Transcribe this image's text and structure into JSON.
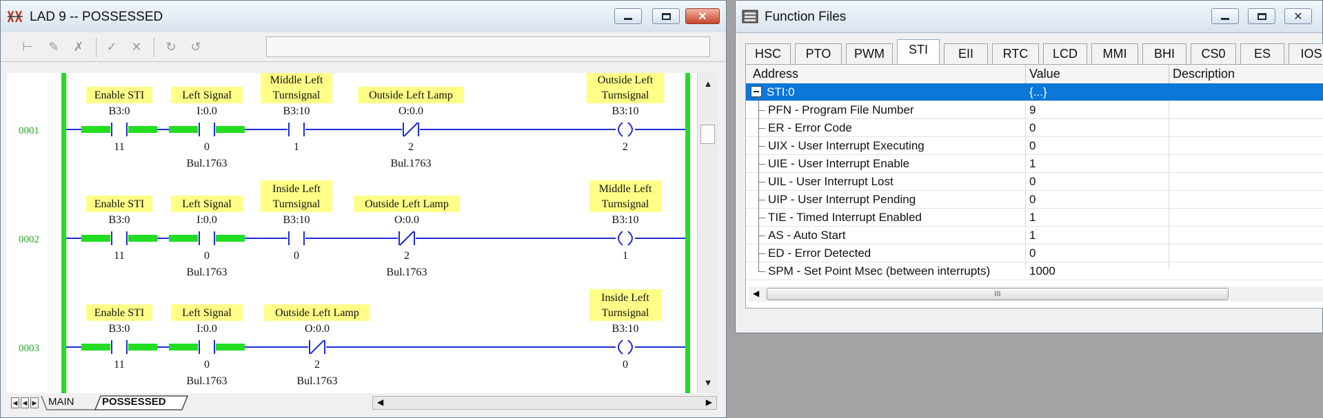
{
  "lad_window": {
    "title": "LAD 9 -- POSSESSED",
    "sheet_tabs": [
      "MAIN",
      "POSSESSED"
    ],
    "rungs": [
      {
        "number": "0001",
        "contacts": [
          {
            "label": [
              "Enable STI"
            ],
            "address": "B3:0",
            "bit": "11",
            "device": "",
            "type": "no",
            "energized": true
          },
          {
            "label": [
              "Left Signal"
            ],
            "address": "I:0.0",
            "bit": "0",
            "device": "Bul.1763",
            "type": "no",
            "energized": true
          },
          {
            "label": [
              "Middle Left",
              "Turnsignal"
            ],
            "address": "B3:10",
            "bit": "1",
            "device": "",
            "type": "no",
            "energized": false
          },
          {
            "label": [
              "Outside Left Lamp"
            ],
            "address": "O:0.0",
            "bit": "2",
            "device": "Bul.1763",
            "type": "nc",
            "energized": false
          }
        ],
        "coil": {
          "label": [
            "Outside Left",
            "Turnsignal"
          ],
          "address": "B3:10",
          "bit": "2"
        }
      },
      {
        "number": "0002",
        "contacts": [
          {
            "label": [
              "Enable STI"
            ],
            "address": "B3:0",
            "bit": "11",
            "device": "",
            "type": "no",
            "energized": true
          },
          {
            "label": [
              "Left Signal"
            ],
            "address": "I:0.0",
            "bit": "0",
            "device": "Bul.1763",
            "type": "no",
            "energized": true
          },
          {
            "label": [
              "Inside Left",
              "Turnsignal"
            ],
            "address": "B3:10",
            "bit": "0",
            "device": "",
            "type": "no",
            "energized": false
          },
          {
            "label": [
              "Outside Left Lamp"
            ],
            "address": "O:0.0",
            "bit": "2",
            "device": "Bul.1763",
            "type": "nc",
            "energized": false
          }
        ],
        "coil": {
          "label": [
            "Middle Left",
            "Turnsignal"
          ],
          "address": "B3:10",
          "bit": "1"
        }
      },
      {
        "number": "0003",
        "contacts": [
          {
            "label": [
              "Enable STI"
            ],
            "address": "B3:0",
            "bit": "11",
            "device": "",
            "type": "no",
            "energized": true
          },
          {
            "label": [
              "Left Signal"
            ],
            "address": "I:0.0",
            "bit": "0",
            "device": "Bul.1763",
            "type": "no",
            "energized": true
          },
          {
            "label": [
              "Outside Left Lamp"
            ],
            "address": "O:0.0",
            "bit": "2",
            "device": "Bul.1763",
            "type": "nc",
            "energized": false
          }
        ],
        "coil": {
          "label": [
            "Inside Left",
            "Turnsignal"
          ],
          "address": "B3:10",
          "bit": "0"
        }
      }
    ]
  },
  "ff_window": {
    "title": "Function Files",
    "tabs": [
      "HSC",
      "PTO",
      "PWM",
      "STI",
      "EII",
      "RTC",
      "LCD",
      "MMI",
      "BHI",
      "CS0",
      "ES",
      "IOS"
    ],
    "active_tab": "STI",
    "columns": [
      "Address",
      "Value",
      "Description"
    ],
    "root": {
      "address": "STI:0",
      "value": "{...}"
    },
    "rows": [
      {
        "address": "PFN - Program File Number",
        "value": "9"
      },
      {
        "address": "ER - Error Code",
        "value": "0"
      },
      {
        "address": "UIX - User Interrupt Executing",
        "value": "0"
      },
      {
        "address": "UIE - User Interrupt Enable",
        "value": "1"
      },
      {
        "address": "UIL - User Interrupt Lost",
        "value": "0"
      },
      {
        "address": "UIP - User Interrupt Pending",
        "value": "0"
      },
      {
        "address": "TIE - Timed Interrupt Enabled",
        "value": "1"
      },
      {
        "address": "AS - Auto Start",
        "value": "1"
      },
      {
        "address": "ED - Error Detected",
        "value": "0"
      },
      {
        "address": "SPM - Set Point Msec (between interrupts)",
        "value": "1000"
      }
    ],
    "scroll_thumb_glyph": "III"
  },
  "colors": {
    "power_rail": "#22dd22",
    "rung_wire": "#1f2bd6",
    "label_bg": "#ffff88",
    "rung_number": "#22aa22",
    "selected_row": "#0a77d9"
  },
  "icons": {
    "lad_title_icon": "ladder-app-icon",
    "ff_title_icon": "function-files-icon"
  }
}
